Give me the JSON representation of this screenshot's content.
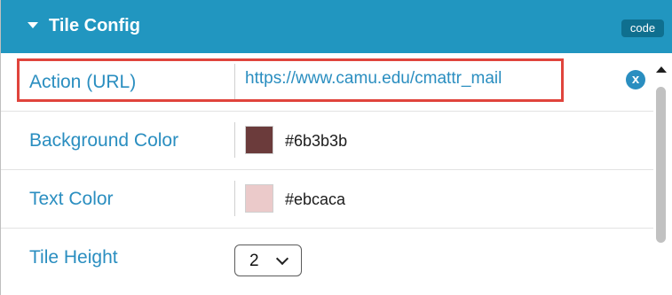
{
  "header": {
    "title": "Tile Config",
    "code_label": "code"
  },
  "rows": [
    {
      "label": "Action (URL)",
      "value": "https://www.camu.edu/cmattr_mail"
    },
    {
      "label": "Background Color",
      "swatch_color": "#6b3b3b",
      "value": "#6b3b3b"
    },
    {
      "label": "Text Color",
      "swatch_color": "#ebcaca",
      "value": "#ebcaca"
    },
    {
      "label": "Tile Height",
      "selected": "2"
    }
  ],
  "clear_button_label": "x",
  "colors": {
    "header_bg": "#2196c0",
    "label_blue": "#2a8ec0",
    "highlight_red": "#e0443c"
  }
}
